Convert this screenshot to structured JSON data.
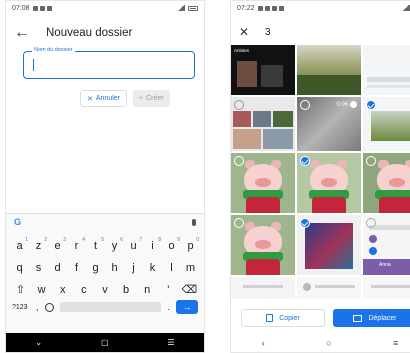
{
  "left": {
    "status": {
      "time": "07:08"
    },
    "appbar": {
      "back_glyph": "←",
      "title": "Nouveau dossier"
    },
    "field": {
      "label": "Nom du dossier",
      "value": ""
    },
    "buttons": {
      "cancel_glyph": "✕",
      "cancel": "Annuler",
      "create_glyph": "+",
      "create": "Créer"
    },
    "keyboard": {
      "brand": "G",
      "row1": [
        {
          "k": "a",
          "n": "1"
        },
        {
          "k": "z",
          "n": "2"
        },
        {
          "k": "e",
          "n": "3"
        },
        {
          "k": "r",
          "n": "4"
        },
        {
          "k": "t",
          "n": "5"
        },
        {
          "k": "y",
          "n": "6"
        },
        {
          "k": "u",
          "n": "7"
        },
        {
          "k": "i",
          "n": "8"
        },
        {
          "k": "o",
          "n": "9"
        },
        {
          "k": "p",
          "n": "0"
        }
      ],
      "row2": [
        "q",
        "s",
        "d",
        "f",
        "g",
        "h",
        "j",
        "k",
        "l",
        "m"
      ],
      "row3": [
        "⇧",
        "w",
        "x",
        "c",
        "v",
        "b",
        "n",
        "'",
        "⌫"
      ],
      "bottom": {
        "sym": "?123",
        "comma": ",",
        "dot": ".",
        "enter": "→"
      }
    },
    "navbar": {
      "back": "⌄",
      "home": "▢",
      "recent": "☰"
    }
  },
  "right": {
    "status": {
      "time": "07:22"
    },
    "appbar": {
      "close_glyph": "✕",
      "count": "3"
    },
    "tiles": {
      "album_label": "Artistes",
      "video_duration": "0:06",
      "contact_name": "Anna"
    },
    "actions": {
      "copy": "Copier",
      "move": "Déplacer"
    },
    "navbar": {
      "back": "‹",
      "home": "○",
      "recent": "≡"
    }
  },
  "colors": {
    "accent": "#1a73e8"
  }
}
